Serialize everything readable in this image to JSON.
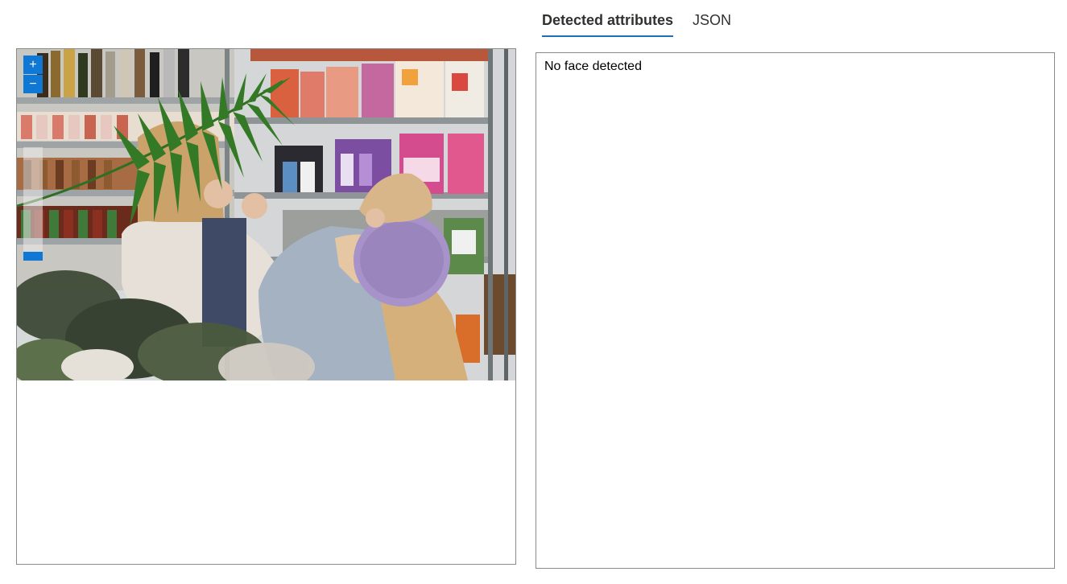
{
  "tabs": [
    {
      "label": "Detected attributes",
      "active": true
    },
    {
      "label": "JSON",
      "active": false
    }
  ],
  "results": {
    "message": "No face detected"
  },
  "zoom_controls": {
    "zoom_in_label": "+",
    "zoom_out_label": "−"
  },
  "colors": {
    "accent": "#0f78d4",
    "tab_underline": "#1f6fb2",
    "panel_border": "#8a8a8a"
  },
  "photo": {
    "description_icon": "shopping-scene-image"
  }
}
